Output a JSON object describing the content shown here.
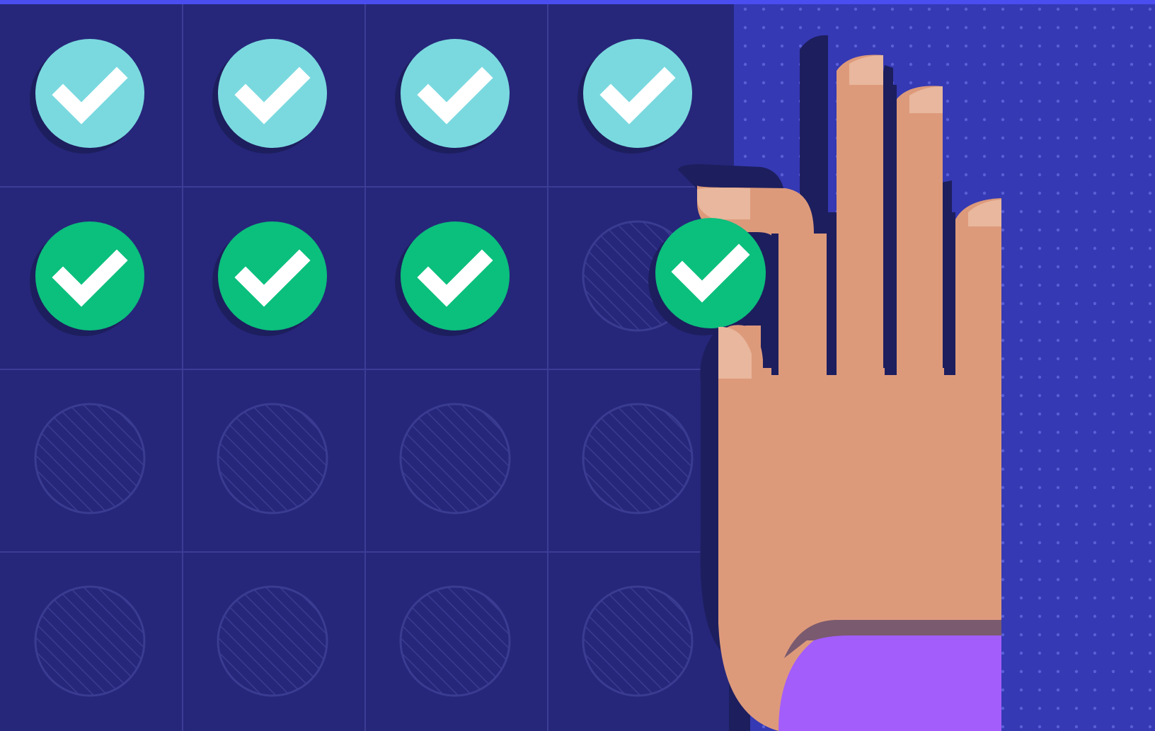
{
  "colors": {
    "top_bar": "#4a4ef0",
    "grid_background": "#26277a",
    "grid_lines": "#3b3d96",
    "right_panel": "#3539b3",
    "dot_pattern": "#5a5fd6",
    "shadow": "#1d1e5e",
    "check_teal": "#7ad9df",
    "check_green": "#0bbf7d",
    "check_mark": "#ffffff",
    "empty_hatch": "#3a3c92",
    "skin": "#dd9a7b",
    "nail": "#e8b79d",
    "sleeve": "#a35dfb",
    "cuff": "#7a5a6e"
  },
  "grid": {
    "rows": 4,
    "cols": 4,
    "cells": [
      [
        "check_teal",
        "check_teal",
        "check_teal",
        "check_teal"
      ],
      [
        "check_green",
        "check_green",
        "check_green",
        "empty"
      ],
      [
        "empty",
        "empty",
        "empty",
        "empty"
      ],
      [
        "empty",
        "empty",
        "empty",
        "empty"
      ]
    ]
  },
  "held_item": {
    "state": "check_green",
    "description_icon": "check-circle-icon"
  },
  "icons": {
    "check": "check-icon",
    "empty": "empty-slot-icon",
    "hand": "hand-icon"
  }
}
